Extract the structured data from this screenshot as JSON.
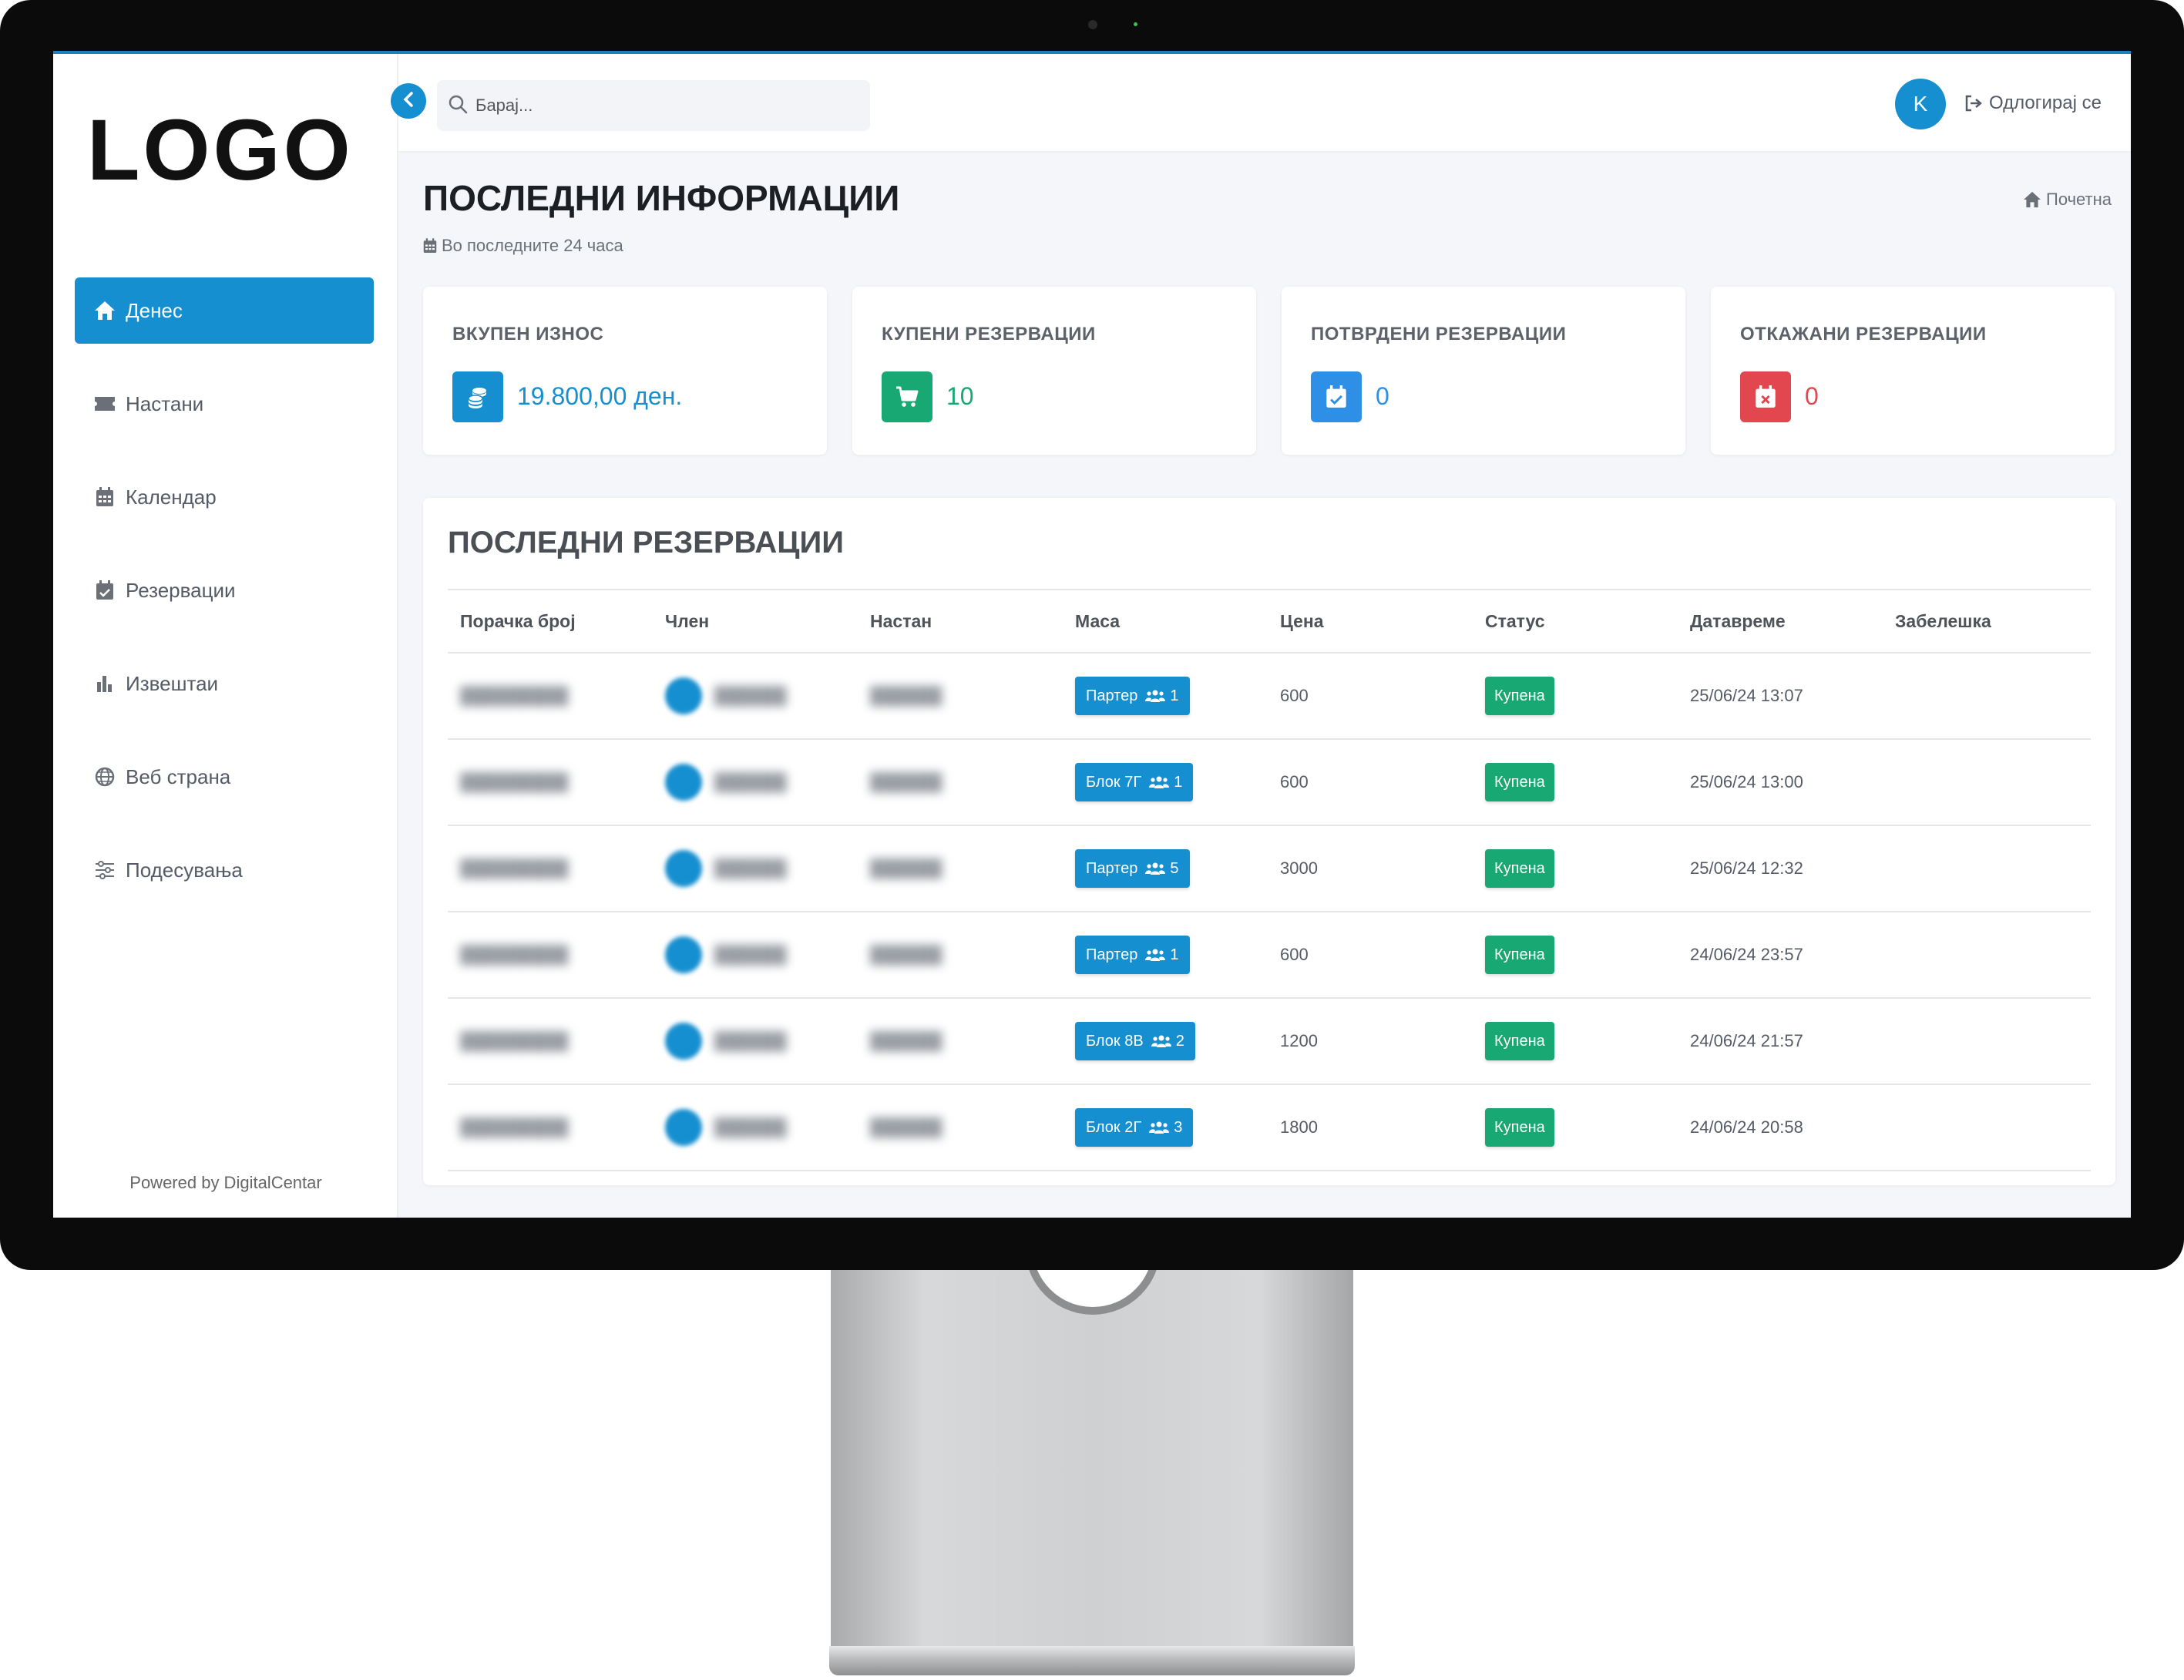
{
  "sidebar": {
    "logo": "LOGO",
    "items": [
      {
        "label": "Денес",
        "icon": "home-icon",
        "active": true
      },
      {
        "label": "Настани",
        "icon": "ticket-icon"
      },
      {
        "label": "Календар",
        "icon": "calendar-icon"
      },
      {
        "label": "Резервации",
        "icon": "calendar-check-icon"
      },
      {
        "label": "Извештаи",
        "icon": "bar-chart-icon"
      },
      {
        "label": "Веб страна",
        "icon": "globe-icon"
      },
      {
        "label": "Подесувања",
        "icon": "sliders-icon"
      }
    ],
    "powered_by": "Powered by DigitalCentar"
  },
  "topbar": {
    "search_placeholder": "Барај...",
    "avatar_initial": "K",
    "logout_label": "Одлогирај се"
  },
  "page": {
    "title": "ПОСЛЕДНИ ИНФОРМАЦИИ",
    "subtitle": "Во последните 24 часа",
    "breadcrumb": "Почетна"
  },
  "cards": [
    {
      "title": "ВКУПЕН ИЗНОС",
      "value": "19.800,00 ден.",
      "icon": "coins-icon",
      "color": "#168fd0"
    },
    {
      "title": "КУПЕНИ РЕЗЕРВАЦИИ",
      "value": "10",
      "icon": "cart-icon",
      "color": "#18a874"
    },
    {
      "title": "ПОТВРДЕНИ РЕЗЕРВАЦИИ",
      "value": "0",
      "icon": "calendar-check-icon",
      "color": "#2e8fe6"
    },
    {
      "title": "ОТКАЖАНИ РЕЗЕРВАЦИИ",
      "value": "0",
      "icon": "calendar-x-icon",
      "color": "#e2464f"
    }
  ],
  "reservations": {
    "title": "ПОСЛЕДНИ РЕЗЕРВАЦИИ",
    "columns": [
      "Порачка број",
      "Член",
      "Настан",
      "Маса",
      "Цена",
      "Статус",
      "Датавреме",
      "Забелешка"
    ],
    "rows": [
      {
        "table": "Партер",
        "guests": "1",
        "price": "600",
        "status": "Купена",
        "datetime": "25/06/24 13:07"
      },
      {
        "table": "Блок 7Г",
        "guests": "1",
        "price": "600",
        "status": "Купена",
        "datetime": "25/06/24 13:00"
      },
      {
        "table": "Партер",
        "guests": "5",
        "price": "3000",
        "status": "Купена",
        "datetime": "25/06/24 12:32"
      },
      {
        "table": "Партер",
        "guests": "1",
        "price": "600",
        "status": "Купена",
        "datetime": "24/06/24 23:57"
      },
      {
        "table": "Блок 8В",
        "guests": "2",
        "price": "1200",
        "status": "Купена",
        "datetime": "24/06/24 21:57"
      },
      {
        "table": "Блок 2Г",
        "guests": "3",
        "price": "1800",
        "status": "Купена",
        "datetime": "24/06/24 20:58"
      }
    ]
  },
  "colors": {
    "accent": "#168fd0",
    "success": "#18a874",
    "danger": "#e2464f"
  }
}
